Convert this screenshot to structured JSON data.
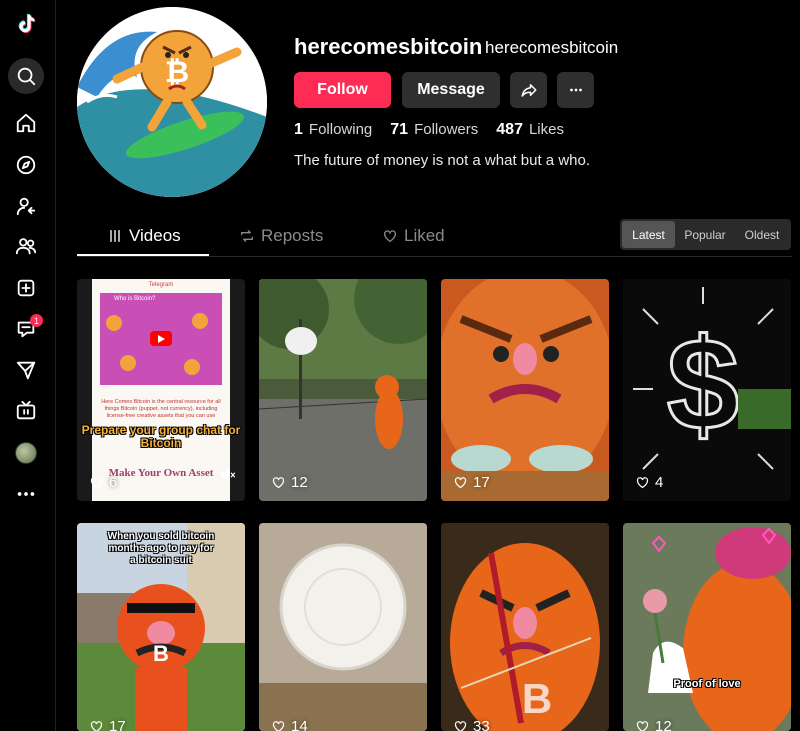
{
  "profile": {
    "username": "herecomesbitcoin",
    "nickname": "herecomesbitcoin",
    "follow_label": "Follow",
    "message_label": "Message",
    "following_count": "1",
    "following_label": "Following",
    "followers_count": "71",
    "followers_label": "Followers",
    "likes_count": "487",
    "likes_label": "Likes",
    "bio": "The future of money is not a what but a who.",
    "avatar_symbol": "₿"
  },
  "sidebar": {
    "notification_badge": "1",
    "icons": [
      "tiktok-logo-icon",
      "search-icon",
      "home-icon",
      "explore-icon",
      "following-icon",
      "friends-icon",
      "upload-icon",
      "inbox-icon",
      "messages-icon",
      "live-icon",
      "profile-avatar-icon",
      "more-icon"
    ]
  },
  "tabs": {
    "videos": "Videos",
    "reposts": "Reposts",
    "liked": "Liked"
  },
  "sort": {
    "latest": "Latest",
    "popular": "Popular",
    "oldest": "Oldest",
    "selected": "Latest"
  },
  "videos": [
    {
      "views": "6",
      "header": "Telegram",
      "subtitle": "Who is Bitcoin?",
      "body": "Here Comes Bitcoin is the central resource for all things Bitcoin (puppet, not currency), including license-free creative assets that you can use",
      "caption": "Prepare your group chat for Bitcoin",
      "footer": "Make Your Own Asset"
    },
    {
      "views": "12"
    },
    {
      "views": "17"
    },
    {
      "views": "4"
    },
    {
      "views": "17",
      "caption": "When you sold bitcoin months ago to pay for a bitcoin suit"
    },
    {
      "views": "14"
    },
    {
      "views": "33"
    },
    {
      "views": "12",
      "caption": "Proof of love"
    }
  ],
  "colors": {
    "accent": "#fe2c55",
    "background": "#000000",
    "button_dark": "#2f2f2f",
    "mascot_orange": "#f07a1e"
  }
}
